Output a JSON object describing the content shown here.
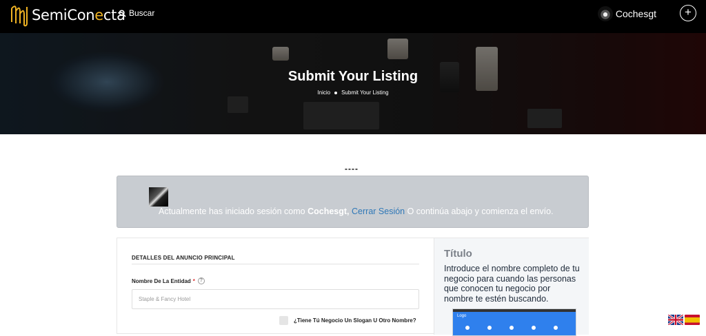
{
  "header": {
    "logo_text_a": "SemiCon",
    "logo_text_b": "e",
    "logo_text_c": "cta",
    "search_label": "Buscar",
    "username": "Cochesgt",
    "add_button": "+"
  },
  "hero": {
    "title": "Submit Your Listing",
    "breadcrumb_home": "Inicio",
    "breadcrumb_current": "Submit Your Listing"
  },
  "divider_text": "----",
  "notice": {
    "prefix": "Actualmente has iniciado sesión como ",
    "user": "Cochesgt,",
    "logout_link": "Cerrar Sesión",
    "suffix": " O continúa abajo y comienza el envío."
  },
  "form": {
    "section_title": "DETALLES DEL ANUNCIO PRINCIPAL",
    "entity_label": "Nombre De La Entidad",
    "required_mark": "*",
    "help_mark": "?",
    "entity_placeholder": "Staple & Fancy Hotel",
    "slogan_label": "¿Tiene Tú Negocio Un Slogan U Otro Nombre?"
  },
  "sidebar_help": {
    "title": "Título",
    "text": "Introduce el nombre completo de tu negocio para cuando las personas que conocen tu negocio por nombre te estén buscando.",
    "preview_logo": "Logo"
  },
  "colors": {
    "brand_accent": "#f0b323",
    "link": "#2f78b7",
    "notice_bg": "#c8ccd1"
  },
  "icons": [
    "logo-icon",
    "search-icon",
    "help-icon",
    "flag-en-icon",
    "flag-es-icon"
  ]
}
